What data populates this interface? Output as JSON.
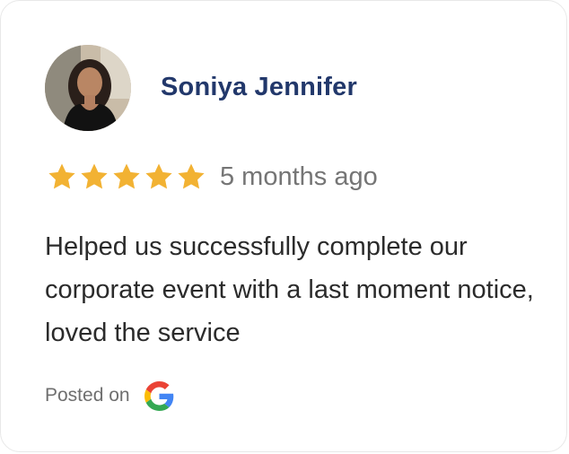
{
  "review": {
    "reviewer_name": "Soniya Jennifer",
    "rating": 5,
    "rating_max": 5,
    "time_ago": "5 months ago",
    "text": "Helped us successfully complete our corporate event with a last moment notice, loved the service",
    "posted_on_label": "Posted on",
    "platform_icon": "google-logo"
  },
  "colors": {
    "name": "#22386b",
    "star": "#f2b233",
    "muted_text": "#757575",
    "body_text": "#2b2b2b"
  }
}
